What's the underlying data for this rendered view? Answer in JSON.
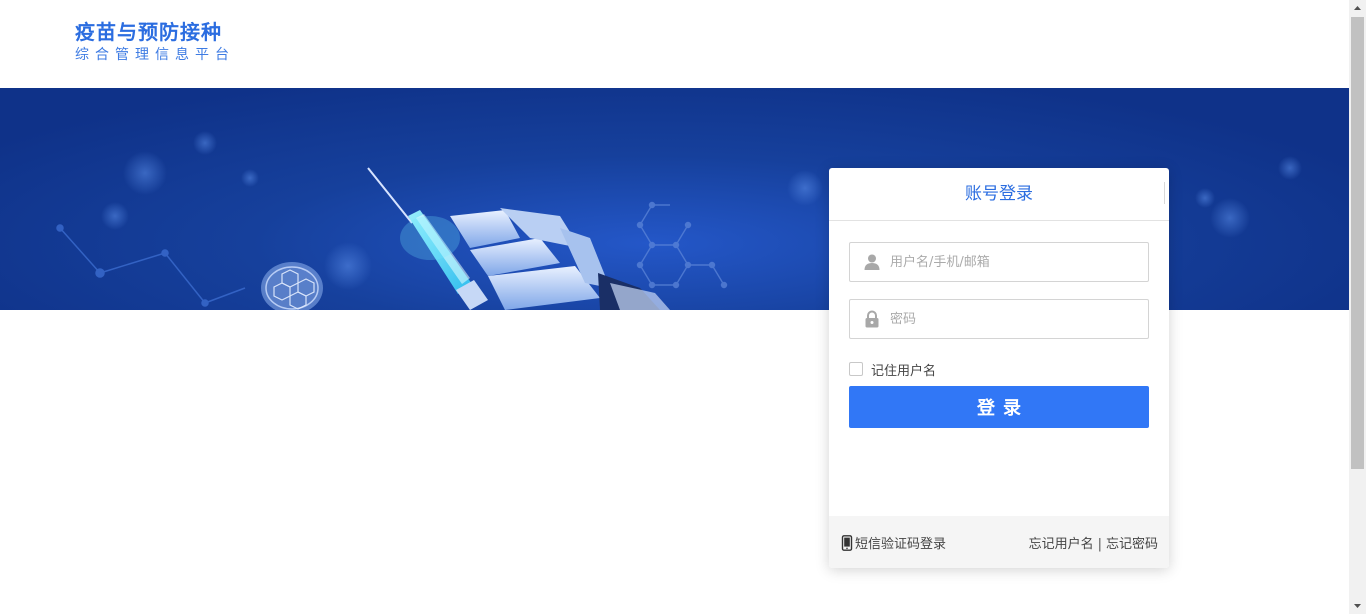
{
  "header": {
    "logo_title": "疫苗与预防接种",
    "logo_subtitle": "综合管理信息平台"
  },
  "login": {
    "title": "账号登录",
    "username_placeholder": "用户名/手机/邮箱",
    "password_placeholder": "密码",
    "remember_label": "记住用户名",
    "remember_checked": false,
    "submit_label": "登录"
  },
  "footer": {
    "sms_login_label": "短信验证码登录",
    "forgot_username_label": "忘记用户名",
    "separator": "|",
    "forgot_password_label": "忘记密码"
  },
  "colors": {
    "brand_blue": "#2b6de0",
    "button_blue": "#3177f6",
    "banner_blue": "#16409c"
  },
  "icons": {
    "username": "user-icon",
    "password": "lock-icon",
    "sms": "mobile-phone-icon"
  }
}
